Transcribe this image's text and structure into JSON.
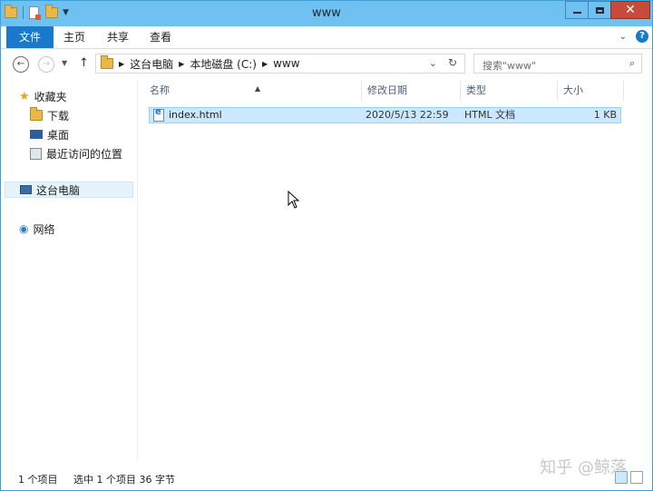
{
  "window": {
    "title": "www"
  },
  "ribbon": {
    "tabs": [
      "文件",
      "主页",
      "共享",
      "查看"
    ]
  },
  "address": {
    "breadcrumbs": [
      "这台电脑",
      "本地磁盘 (C:)",
      "www"
    ],
    "search_placeholder": "搜索\"www\""
  },
  "nav": {
    "favorites": "收藏夹",
    "downloads": "下载",
    "desktop": "桌面",
    "recent": "最近访问的位置",
    "this_pc": "这台电脑",
    "network": "网络"
  },
  "columns": {
    "name": "名称",
    "modified": "修改日期",
    "type": "类型",
    "size": "大小"
  },
  "files": [
    {
      "name": "index.html",
      "modified": "2020/5/13 22:59",
      "type": "HTML 文档",
      "size": "1 KB"
    }
  ],
  "status": {
    "count": "1 个项目",
    "selected": "选中 1 个项目  36 字节"
  },
  "watermark": "知乎 @鲸落",
  "colors": {
    "titlebar": "#6ec1f0",
    "file_tab": "#1979ca",
    "selection": "#cce8ff",
    "close": "#c74a3c"
  }
}
